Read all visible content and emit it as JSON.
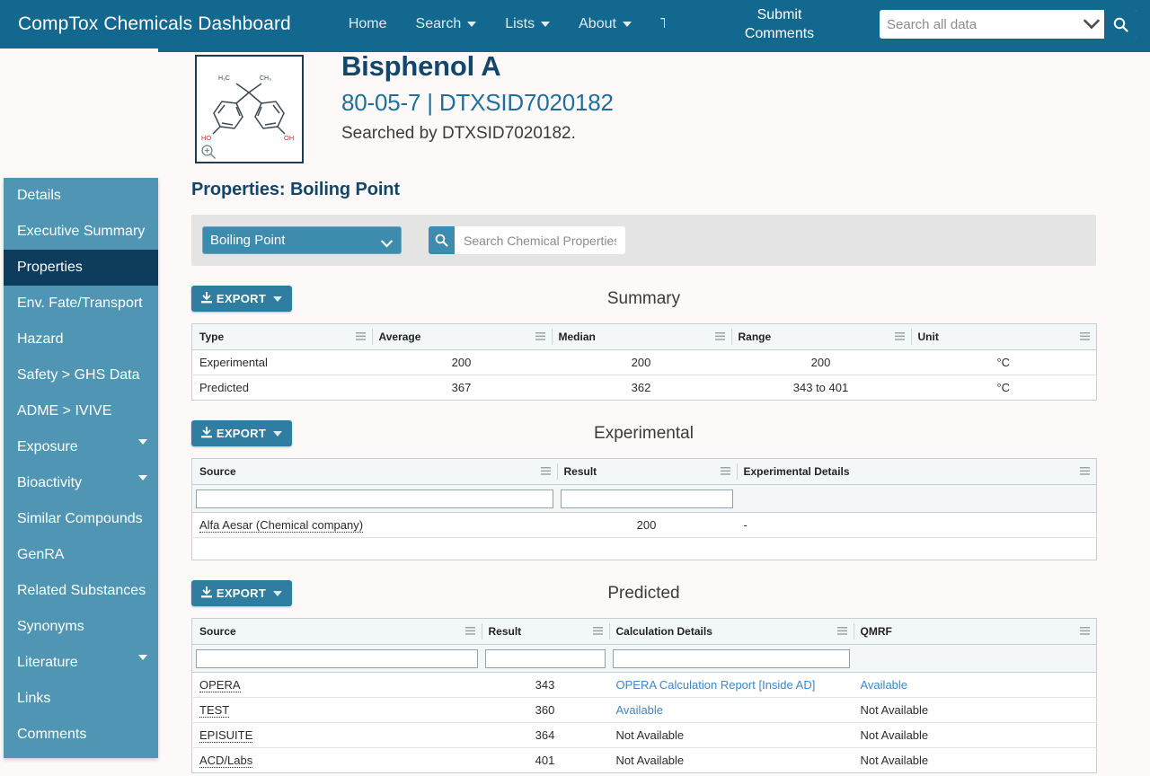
{
  "navbar": {
    "brand": "CompTox Chemicals Dashboard",
    "links": [
      {
        "label": "Home",
        "caret": false
      },
      {
        "label": "Search",
        "caret": true
      },
      {
        "label": "Lists",
        "caret": true
      },
      {
        "label": "About",
        "caret": true
      },
      {
        "label": "Tools",
        "caret": true
      }
    ],
    "submit_comments": {
      "line1": "Submit",
      "line2": "Comments"
    },
    "search_placeholder": "Search all data",
    "search_value": "",
    "search_icon": "search-icon",
    "dropdown_icon": "chevron-down-icon",
    "bg_color": "#12688f"
  },
  "hero": {
    "chemical_name": "Bisphenol A",
    "identifiers": "80-05-7 | DTXSID7020182",
    "searched_by": "Searched by DTXSID7020182.",
    "structure_alt": "chemical-structure-bisphenol-a",
    "zoom_icon": "magnifier-plus-icon",
    "structure_labels": {
      "left_methyl": "H3C",
      "right_methyl": "CH3",
      "left_hydroxyl": "HO",
      "right_hydroxyl": "OH"
    }
  },
  "sidebar": {
    "active": "Properties",
    "bg_color": "#5096b4",
    "active_color": "#0d3c5c",
    "items": [
      {
        "label": "Details",
        "caret": false
      },
      {
        "label": "Executive Summary",
        "caret": false
      },
      {
        "label": "Properties",
        "caret": false
      },
      {
        "label": "Env. Fate/Transport",
        "caret": false
      },
      {
        "label": "Hazard",
        "caret": false
      },
      {
        "label": "Safety > GHS Data",
        "caret": false
      },
      {
        "label": "ADME > IVIVE",
        "caret": false
      },
      {
        "label": "Exposure",
        "caret": true
      },
      {
        "label": "Bioactivity",
        "caret": true
      },
      {
        "label": "Similar Compounds",
        "caret": false
      },
      {
        "label": "GenRA",
        "caret": false
      },
      {
        "label": "Related Substances",
        "caret": false
      },
      {
        "label": "Synonyms",
        "caret": false
      },
      {
        "label": "Literature",
        "caret": true
      },
      {
        "label": "Links",
        "caret": false
      },
      {
        "label": "Comments",
        "caret": false
      }
    ]
  },
  "main": {
    "page_title": "Properties: Boiling Point",
    "property_select": {
      "selected": "Boiling Point",
      "options": [
        "Boiling Point"
      ]
    },
    "property_search": {
      "placeholder": "Search Chemical Properties",
      "value": "",
      "icon": "search-icon"
    },
    "export_label": "EXPORT",
    "export_icon": "download-icon",
    "summary": {
      "title": "Summary",
      "columns": [
        "Type",
        "Average",
        "Median",
        "Range",
        "Unit"
      ],
      "rows": [
        {
          "type": "Experimental",
          "average": "200",
          "median": "200",
          "range": "200",
          "unit": "°C"
        },
        {
          "type": "Predicted",
          "average": "367",
          "median": "362",
          "range": "343 to 401",
          "unit": "°C"
        }
      ]
    },
    "experimental": {
      "title": "Experimental",
      "columns": [
        "Source",
        "Result",
        "Experimental Details"
      ],
      "filters": [
        "",
        "",
        ""
      ],
      "rows": [
        {
          "source": "Alfa Aesar (Chemical company)",
          "result": "200",
          "details": "-"
        }
      ]
    },
    "predicted": {
      "title": "Predicted",
      "columns": [
        "Source",
        "Result",
        "Calculation Details",
        "QMRF"
      ],
      "filters": [
        "",
        "",
        "",
        ""
      ],
      "rows": [
        {
          "source": "OPERA",
          "result": "343",
          "calc": "OPERA Calculation Report [Inside AD]",
          "calc_link": true,
          "qmrf": "Available",
          "qmrf_link": true
        },
        {
          "source": "TEST",
          "result": "360",
          "calc": "Available",
          "calc_link": true,
          "qmrf": "Not Available",
          "qmrf_link": false
        },
        {
          "source": "EPISUITE",
          "result": "364",
          "calc": "Not Available",
          "calc_link": false,
          "qmrf": "Not Available",
          "qmrf_link": false
        },
        {
          "source": "ACD/Labs",
          "result": "401",
          "calc": "Not Available",
          "calc_link": false,
          "qmrf": "Not Available",
          "qmrf_link": false
        }
      ]
    }
  }
}
